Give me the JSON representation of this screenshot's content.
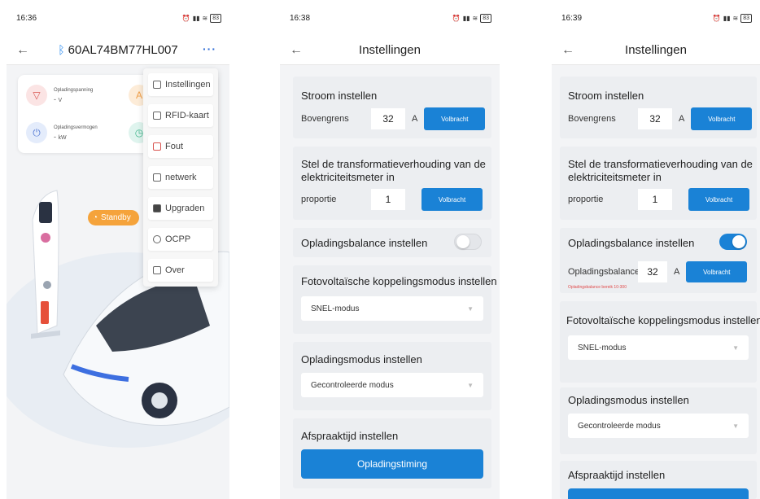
{
  "phone1": {
    "time": "16:36",
    "battery": "83",
    "device_id": "60AL74BM77HL007",
    "more": "···",
    "stats": [
      {
        "label": "Opladingspanning",
        "value": "-",
        "unit": "V"
      },
      {
        "label": "Opladingsvermogen",
        "value": "-",
        "unit": "kW"
      }
    ],
    "status_badge": "Standby",
    "menu": [
      {
        "label": "Instellingen",
        "icon": "settings-icon"
      },
      {
        "label": "RFID-kaart",
        "icon": "card-icon"
      },
      {
        "label": "Fout",
        "icon": "error-icon"
      },
      {
        "label": "netwerk",
        "icon": "network-icon"
      },
      {
        "label": "Upgraden",
        "icon": "upgrade-icon"
      },
      {
        "label": "OCPP",
        "icon": "ocpp-icon"
      },
      {
        "label": "Over",
        "icon": "about-icon"
      }
    ]
  },
  "phone2": {
    "time": "16:38",
    "battery": "83",
    "title": "Instellingen",
    "current": {
      "title": "Stroom instellen",
      "label": "Bovengrens",
      "value": "32",
      "unit": "A",
      "button": "Volbracht"
    },
    "ratio": {
      "title": "Stel de transformatieverhouding van de elektriciteitsmeter in",
      "label": "proportie",
      "value": "1",
      "button": "Volbracht"
    },
    "balance": {
      "title": "Opladingsbalance instellen",
      "enabled": false
    },
    "pv": {
      "title": "Fotovoltaïsche koppelingsmodus instellen",
      "selected": "SNEL-modus"
    },
    "mode": {
      "title": "Opladingsmodus instellen",
      "selected": "Gecontroleerde modus"
    },
    "appointment": {
      "title": "Afspraaktijd instellen",
      "button": "Opladingstiming"
    }
  },
  "phone3": {
    "time": "16:39",
    "battery": "83",
    "title": "Instellingen",
    "current": {
      "title": "Stroom instellen",
      "label": "Bovengrens",
      "value": "32",
      "unit": "A",
      "button": "Volbracht"
    },
    "ratio": {
      "title": "Stel de transformatieverhouding van de elektriciteitsmeter in",
      "label": "proportie",
      "value": "1",
      "button": "Volbracht"
    },
    "balance": {
      "title": "Opladingsbalance instellen",
      "enabled": true,
      "label": "Opladingsbalance",
      "value": "32",
      "unit": "A",
      "button": "Volbracht",
      "hint": "Opladingsbalance bereik 10-300"
    },
    "pv": {
      "title": "Fotovoltaïsche koppelingsmodus instellen",
      "selected": "SNEL-modus"
    },
    "mode": {
      "title": "Opladingsmodus instellen",
      "selected": "Gecontroleerde modus"
    },
    "appointment": {
      "title": "Afspraaktijd instellen"
    }
  },
  "colors": {
    "accent": "#1a82d6",
    "standby": "#f5a33b",
    "background": "#f3f4f6",
    "card": "#eceef1"
  }
}
